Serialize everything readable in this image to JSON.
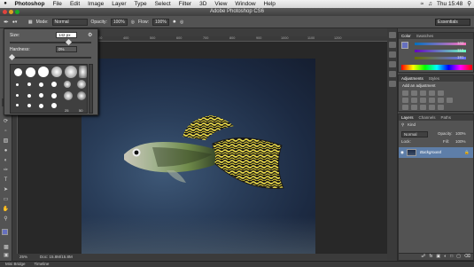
{
  "menubar": {
    "app_name": "Photoshop",
    "items": [
      "File",
      "Edit",
      "Image",
      "Layer",
      "Type",
      "Select",
      "Filter",
      "3D",
      "View",
      "Window",
      "Help"
    ],
    "clock": "Thu 15:48"
  },
  "window": {
    "title": "Adobe Photoshop CS6"
  },
  "options": {
    "mode_label": "Mode:",
    "mode_value": "Normal",
    "opacity_label": "Opacity:",
    "opacity_value": "100%",
    "flow_label": "Flow:",
    "flow_value": "100%",
    "workspace": "Essentials"
  },
  "brush_picker": {
    "size_label": "Size:",
    "size_value": "142 px",
    "hardness_label": "Hardness:",
    "hardness_value": "0%",
    "size_fraction": 0.72,
    "hardness_fraction": 0.0,
    "preset_numbers": [
      "25",
      "50"
    ]
  },
  "rulers": {
    "top": [
      "0",
      "100",
      "200",
      "300",
      "400",
      "500",
      "600",
      "700",
      "800",
      "900",
      "1000",
      "1100",
      "1200"
    ]
  },
  "document_status": {
    "zoom": "25%",
    "doc": "Doc: 15.8M/15.8M"
  },
  "color_panel": {
    "tabs": [
      "Color",
      "Swatches"
    ],
    "r": "102",
    "g": "112",
    "b": "191",
    "fg_color": "#6670bf"
  },
  "adjustments_panel": {
    "tabs": [
      "Adjustments",
      "Styles"
    ],
    "heading": "Add an adjustment"
  },
  "layers_panel": {
    "tabs": [
      "Layers",
      "Channels",
      "Paths"
    ],
    "kind_label": "Kind",
    "blend_mode": "Normal",
    "opacity_label": "Opacity:",
    "opacity_value": "100%",
    "lock_label": "Lock:",
    "fill_label": "Fill:",
    "fill_value": "100%",
    "layer_name": "Background"
  },
  "dock": {
    "tabs": [
      "Mini Bridge",
      "Timeline"
    ]
  }
}
